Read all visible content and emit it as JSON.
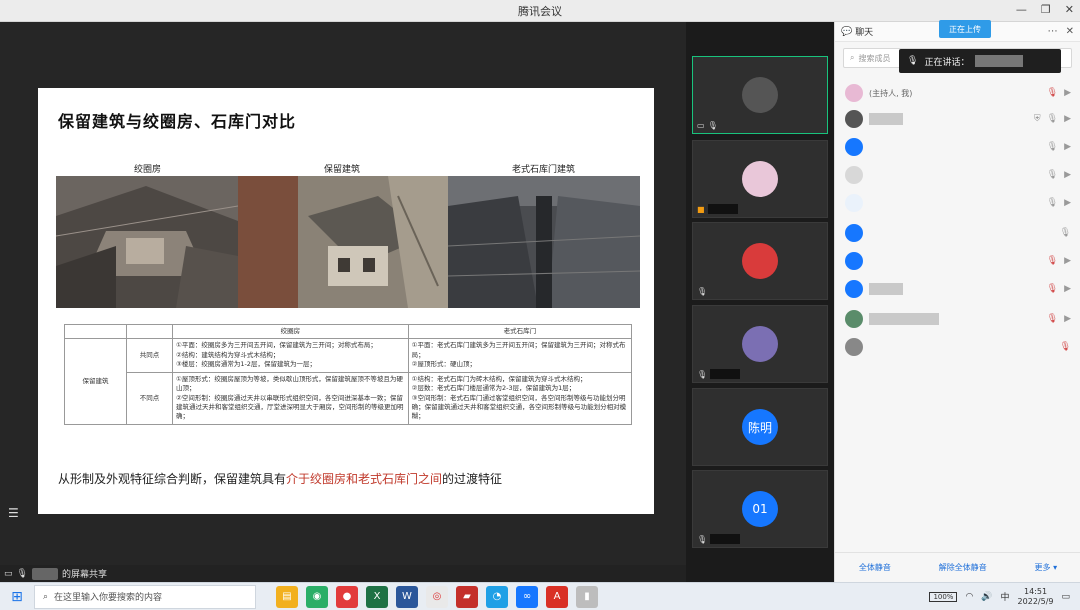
{
  "window": {
    "title": "腾讯会议"
  },
  "slide": {
    "title": "保留建筑与绞圈房、石库门对比",
    "captions": [
      "绞圈房",
      "保留建筑",
      "老式石库门建筑"
    ],
    "table": {
      "col_headers": [
        "绞圈房",
        "老式石库门"
      ],
      "row_group": "保留建筑",
      "rows": [
        {
          "label": "共同点",
          "col1": "①平面：绞圈房多为三开间五开间，保留建筑为三开间；对称式布局；\n②结构：建筑结构为穿斗式木结构；\n③楼层：绞圈房通常为1-2层，保留建筑为一层；",
          "col2": "①平面：老式石库门建筑多为三开间五开间；保留建筑为三开间；对称式布局；\n②屋顶形式：硬山顶；"
        },
        {
          "label": "不同点",
          "col1": "①屋顶形式：绞圈房屋顶为等坡，类似歇山顶形式，保留建筑屋顶不等坡且为硬山顶；\n②空间形制：绞圈房通过天井以串联形式组织空间，各空间进深基本一致；保留建筑通过天井和客堂组织交通，厅堂进深明显大于厢房，空间形制的等级更加明确；",
          "col2": "①结构：老式石库门为砖木结构，保留建筑为穿斗式木结构；\n②层数：老式石库门楼层通常为2-3层，保留建筑为1层；\n③空间形制：老式石库门通过客堂组织空间，各空间形制等级与功能划分明确；保留建筑通过天井和客堂组织交通，各空间形制等级与功能划分相对模糊；"
        }
      ]
    },
    "conclusion_prefix": "从形制及外观特征综合判断，保留建筑具有",
    "conclusion_highlight": "介于绞圈房和老式石库门之间",
    "conclusion_suffix": "的过渡特征"
  },
  "sharebar": {
    "label": "的屏幕共享"
  },
  "videos": [
    {
      "avatar_text": ""
    },
    {
      "avatar_text": ""
    },
    {
      "avatar_text": ""
    },
    {
      "avatar_text": ""
    },
    {
      "avatar_text": "陈明"
    },
    {
      "avatar_text": "01"
    }
  ],
  "panel": {
    "tab_label": "聊天",
    "upload_label": "正在上传",
    "search_placeholder": "搜索成员",
    "speaking_label": "正在讲话：",
    "host_label": "(主持人, 我)",
    "mute_all": "全体静音",
    "unmute_all": "解除全体静音",
    "more": "更多 ▾"
  },
  "taskbar": {
    "search_placeholder": "在这里输入你要搜索的内容",
    "battery": "100%",
    "ime": "中",
    "time": "14:51",
    "date": "2022/5/9"
  },
  "colors": {
    "accent": "#1677ff",
    "active_tile": "#19c37d",
    "highlight_text": "#c0392b"
  }
}
